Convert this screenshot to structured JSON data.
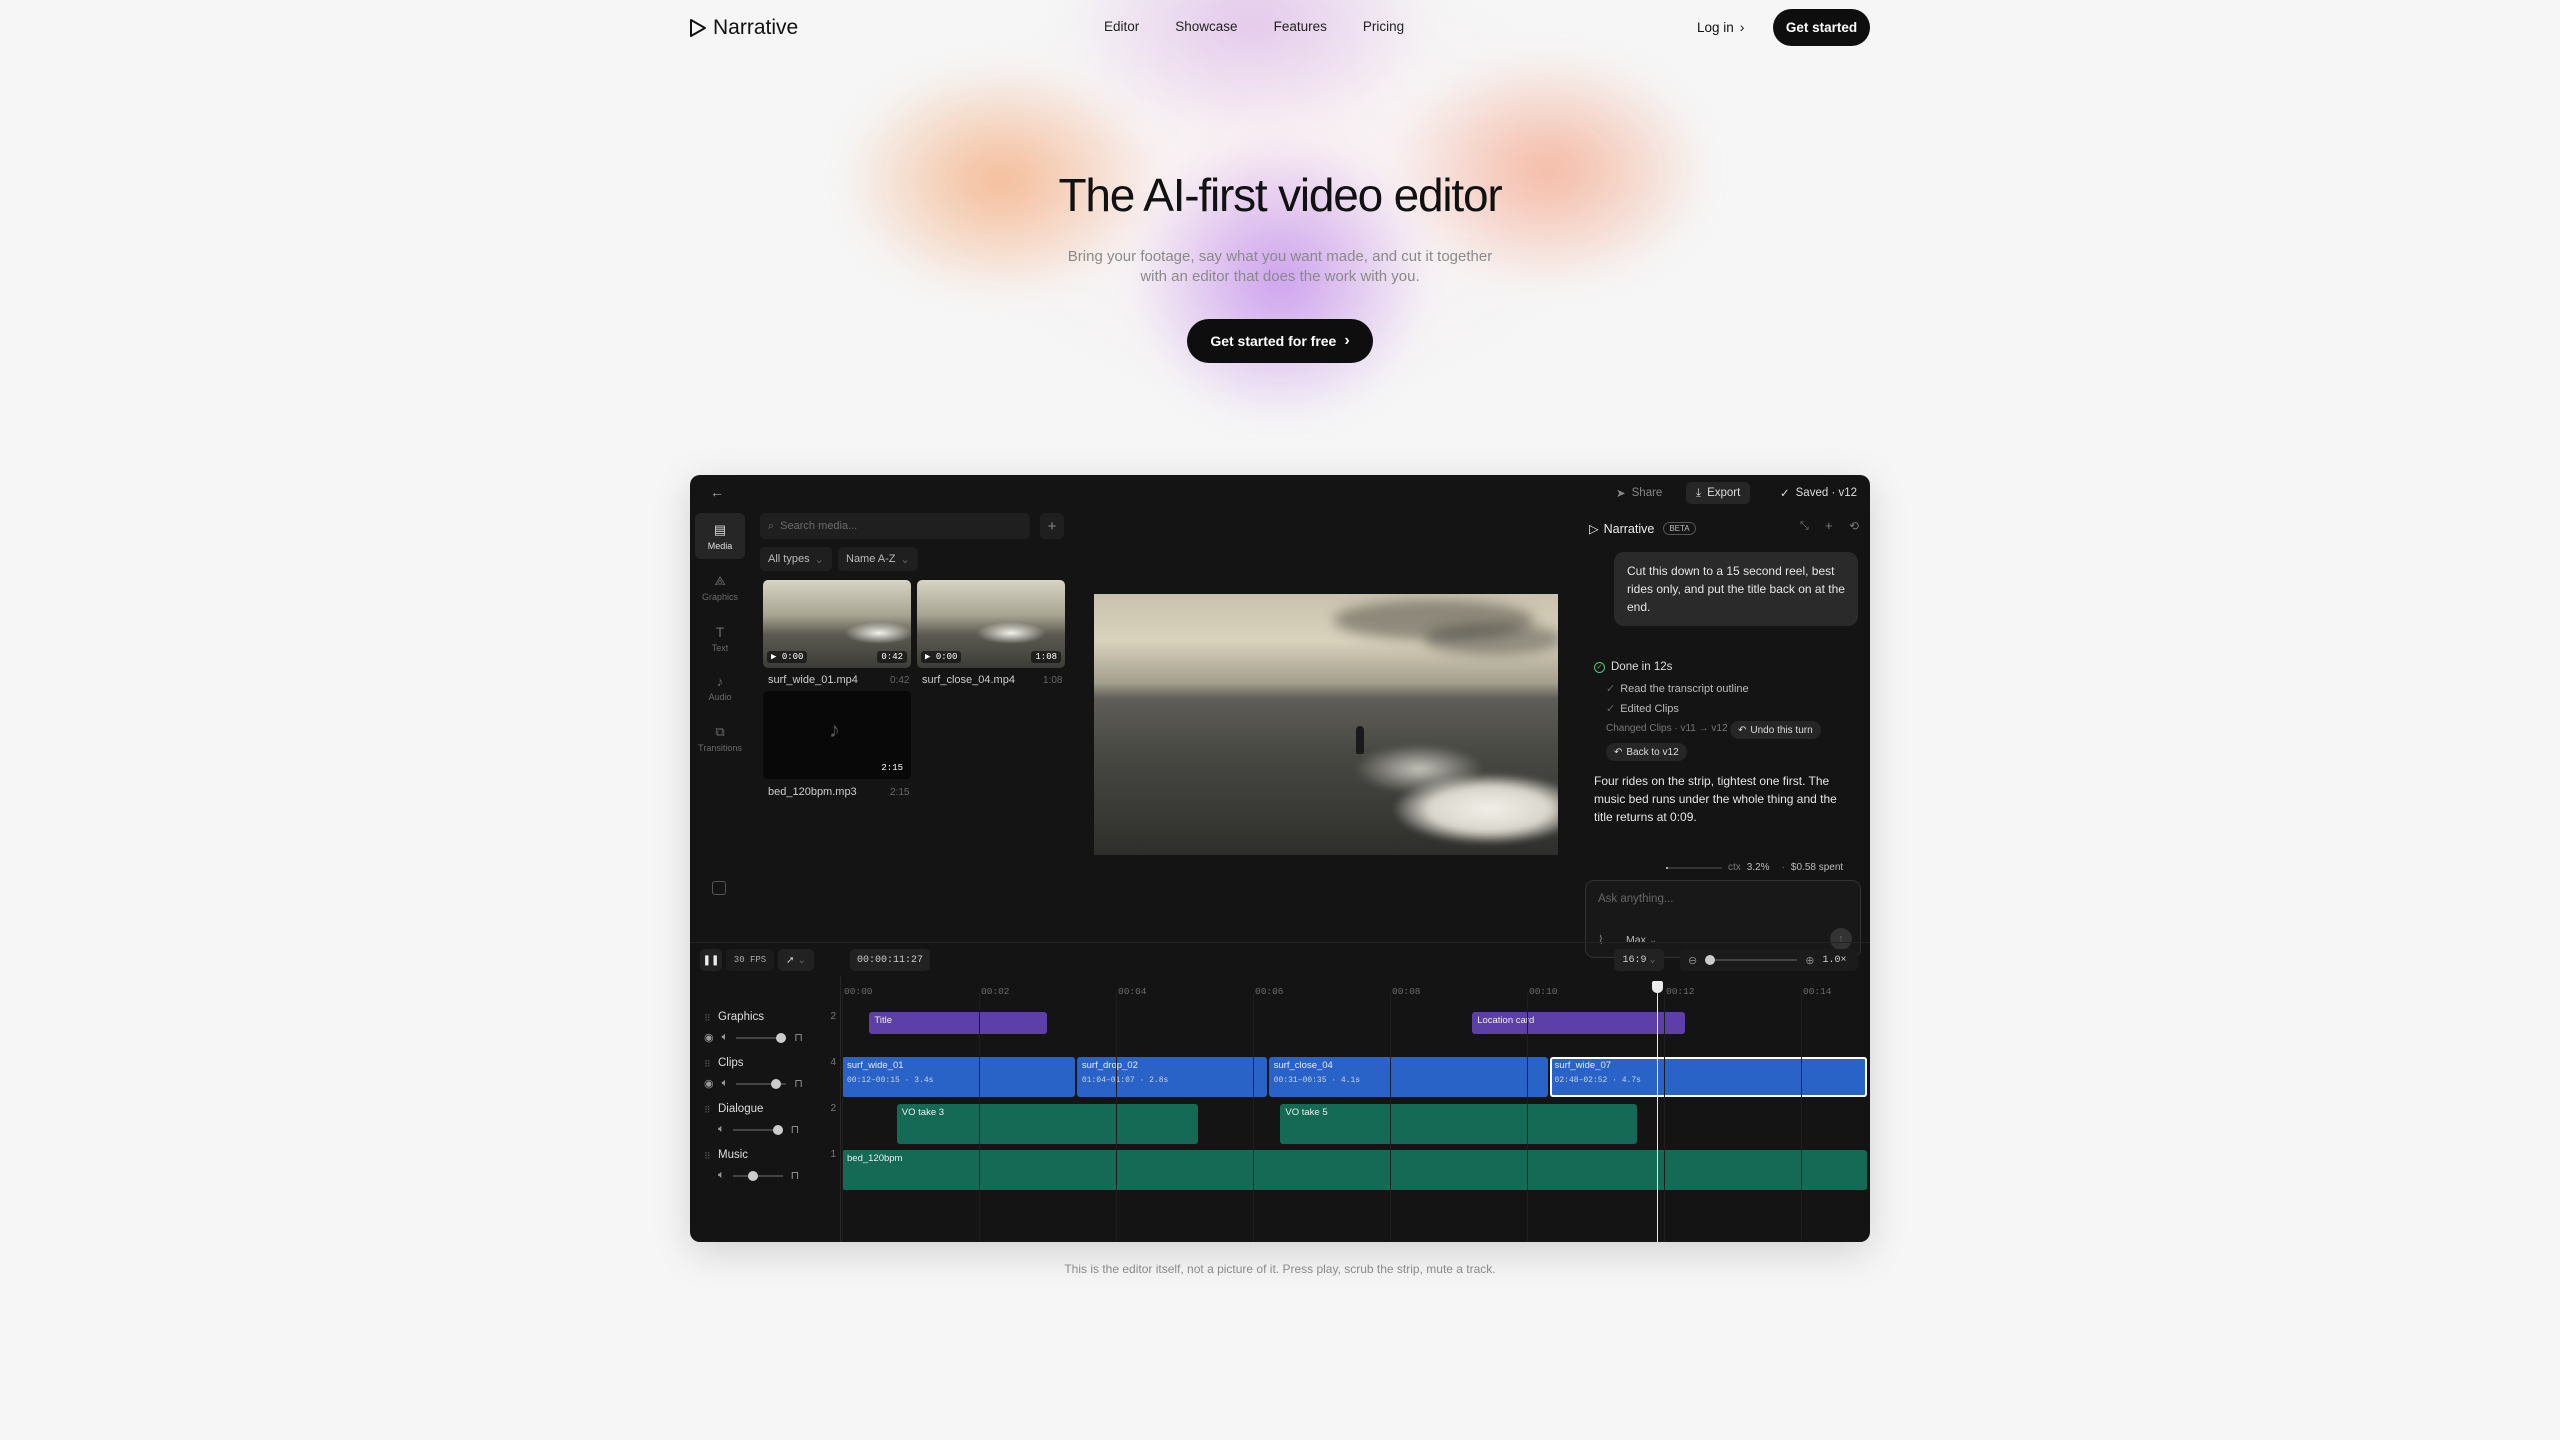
{
  "nav": {
    "brand": "Narrative",
    "links": [
      "Editor",
      "Showcase",
      "Features",
      "Pricing"
    ],
    "login": "Log in",
    "cta": "Get started"
  },
  "hero": {
    "title": "The AI-first video editor",
    "subtitle": "Bring your footage, say what you want made, and cut it together with an editor that does the work with you.",
    "cta": "Get started for free"
  },
  "caption": "This is the editor itself, not a picture of it. Press play, scrub the strip, mute a track.",
  "editor": {
    "topbar": {
      "share": "Share",
      "export": "Export",
      "saved": "Saved · v12"
    },
    "rail": [
      {
        "label": "Media",
        "icon": "media-icon"
      },
      {
        "label": "Graphics",
        "icon": "graphics-icon"
      },
      {
        "label": "Text",
        "icon": "text-icon"
      },
      {
        "label": "Audio",
        "icon": "audio-icon"
      },
      {
        "label": "Transitions",
        "icon": "transitions-icon"
      }
    ],
    "media": {
      "search_placeholder": "Search media...",
      "filter_type": "All types",
      "filter_sort": "Name A-Z",
      "items": [
        {
          "name": "surf_wide_01.mp4",
          "dur": "0:42",
          "tag_start": "▶ 0:00",
          "tag_end": "0:42"
        },
        {
          "name": "surf_close_04.mp4",
          "dur": "1:08",
          "tag_start": "▶ 0:00",
          "tag_end": "1:08"
        },
        {
          "name": "bed_120bpm.mp3",
          "dur": "2:15",
          "tag_end": "2:15"
        }
      ]
    },
    "chat": {
      "brand": "Narrative",
      "beta": "BETA",
      "prompt": "Cut this down to a 15 second reel, best rides only, and put the title back on at the end.",
      "done": "Done in 12s",
      "steps": [
        "Read the transcript outline",
        "Edited Clips"
      ],
      "changed": "Changed Clips · v11 → v12",
      "undo": "Undo this turn",
      "back": "Back to v12",
      "response": "Four rides on the strip, tightest one first. The music bed runs under the whole thing and the title returns at 0:09.",
      "ctx_label": "ctx",
      "ctx_value": "3.2%",
      "spent": "$0.58 spent",
      "input_placeholder": "Ask anything...",
      "model": "Max"
    },
    "timeline": {
      "fps": "30 FPS",
      "timecode": "00:00:11:27",
      "aspect": "16:9",
      "zoom": "1.0×",
      "ticks": [
        "00:00",
        "00:02",
        "00:04",
        "00:06",
        "00:08",
        "00:10",
        "00:12",
        "00:14"
      ],
      "playhead_seconds": 11.9,
      "tracks": [
        {
          "name": "Graphics",
          "count": "2"
        },
        {
          "name": "Clips",
          "count": "4"
        },
        {
          "name": "Dialogue",
          "count": "2"
        },
        {
          "name": "Music",
          "count": "1"
        }
      ],
      "track_volume": {
        "Graphics": 0.9,
        "Clips": 0.8,
        "Dialogue": 0.9,
        "Music": 0.4
      },
      "clips": {
        "graphics": [
          {
            "label": "Title",
            "start": 0.4,
            "end": 3.0
          },
          {
            "label": "Location card",
            "start": 9.2,
            "end": 12.3
          }
        ],
        "video": [
          {
            "label": "surf_wide_01",
            "meta": "00:12–00:15 · 3.4s",
            "start": 0,
            "end": 3.4
          },
          {
            "label": "surf_drop_02",
            "meta": "01:04–01:07 · 2.8s",
            "start": 3.4,
            "end": 6.2
          },
          {
            "label": "surf_close_04",
            "meta": "00:31–00:35 · 4.1s",
            "start": 6.2,
            "end": 10.3
          },
          {
            "label": "surf_wide_07",
            "meta": "02:48–02:52 · 4.7s",
            "start": 10.3,
            "end": 15.0
          }
        ],
        "dialogue": [
          {
            "label": "VO take 3",
            "start": 0.8,
            "end": 5.2
          },
          {
            "label": "VO take 5",
            "start": 6.4,
            "end": 11.6
          }
        ],
        "music": [
          {
            "label": "bed_120bpm",
            "start": 0,
            "end": 15.0
          }
        ]
      }
    }
  },
  "colors": {
    "accent_blue": "#2a63c8",
    "graphics_purple": "#5d3fa8",
    "audio_green": "#146a55",
    "dark": "#141414"
  }
}
